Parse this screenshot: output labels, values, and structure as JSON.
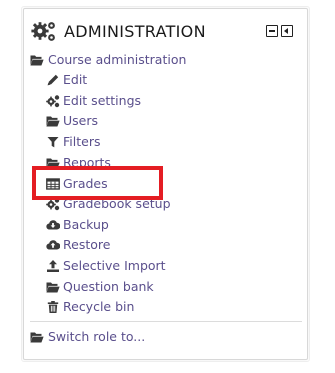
{
  "block": {
    "title": "ADMINISTRATION",
    "header_icon": "gears-icon",
    "controls": [
      "collapse-icon",
      "dock-icon"
    ]
  },
  "course_admin": {
    "label": "Course administration",
    "icon": "folder-open-icon",
    "items": [
      {
        "label": "Edit",
        "icon": "pencil-icon"
      },
      {
        "label": "Edit settings",
        "icon": "gears-icon"
      },
      {
        "label": "Users",
        "icon": "folder-open-icon"
      },
      {
        "label": "Filters",
        "icon": "filter-icon"
      },
      {
        "label": "Reports",
        "icon": "folder-open-icon"
      },
      {
        "label": "Grades",
        "icon": "table-icon"
      },
      {
        "label": "Gradebook setup",
        "icon": "gears-icon"
      },
      {
        "label": "Backup",
        "icon": "cloud-download-icon"
      },
      {
        "label": "Restore",
        "icon": "cloud-upload-icon"
      },
      {
        "label": "Selective Import",
        "icon": "upload-icon"
      },
      {
        "label": "Question bank",
        "icon": "folder-open-icon"
      },
      {
        "label": "Recycle bin",
        "icon": "trash-icon"
      }
    ]
  },
  "switch_role": {
    "label": "Switch role to...",
    "icon": "folder-open-icon"
  },
  "highlight": {
    "target": "Grades",
    "color": "#e41d23"
  },
  "colors": {
    "link": "#5a4f8c",
    "title": "#1a1a1a",
    "icon": "#3a3a3a",
    "highlight": "#e41d23"
  }
}
